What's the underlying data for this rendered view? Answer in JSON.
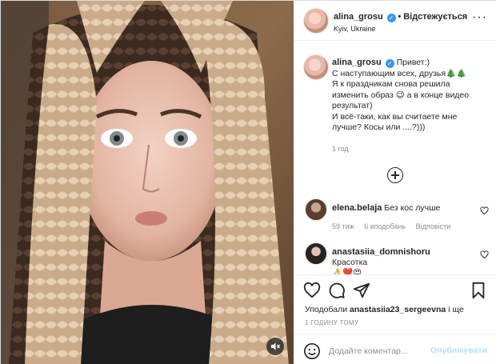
{
  "post": {
    "author": "alina_grosu",
    "follow_status": "Відстежується",
    "location": "Kyiv, Ukraine",
    "caption_lines": [
      "Привет:)",
      "С наступающим всех, друзья🎄🎄",
      "Я к праздникам снова решила изменить образ 😉 а в конце видео результат)",
      "И всё-таки, как вы считаете мне лучше? Косы или ....?)))"
    ],
    "caption_age": "1 год"
  },
  "comments": [
    {
      "user": "elena.belaja",
      "text": "Без кос лучше",
      "age": "59 тиж",
      "likes": "6 вподобань",
      "reply": "Відповісти"
    },
    {
      "user": "anastasiia_domnishoru",
      "text": "Красотка",
      "emoji": "👌❤️😍"
    }
  ],
  "likes": {
    "prefix": "Уподобали",
    "user": "anastasiia23_sergeevna",
    "suffix": "і ще"
  },
  "post_time": "1 ГОДИНУ ТОМУ",
  "comment_input": {
    "placeholder": "Додайте коментар..."
  },
  "publish_label": "Опублікувати",
  "colors": {
    "accent": "#3897f0",
    "publish_disabled": "#b2dffc",
    "muted": "#8e8e8e"
  }
}
